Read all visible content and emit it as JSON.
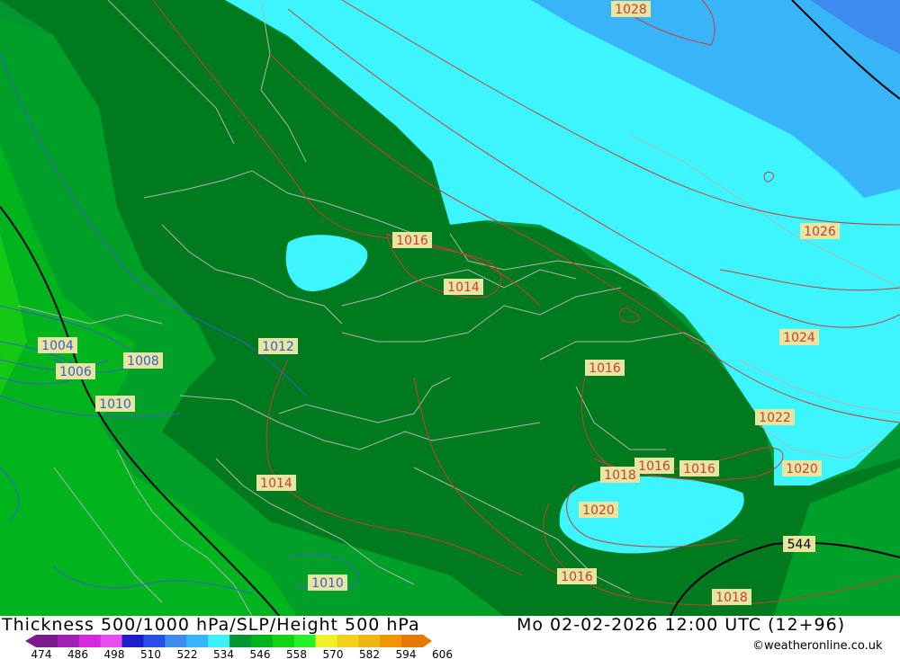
{
  "title": "Thickness 500/1000 hPa/SLP/Height 500 hPa",
  "datetime": "Mo 02-02-2026 12:00 UTC (12+96)",
  "credit": "©weatheronline.co.uk",
  "colors": {
    "isobar": "#cc3c3c",
    "isobar_low": "#3c5ad2",
    "height_contour": "#000000",
    "border": "#b4b4b4",
    "label_bg": "#e6e6a0"
  },
  "legend": {
    "ticks": [
      "474",
      "486",
      "498",
      "510",
      "522",
      "534",
      "546",
      "558",
      "570",
      "582",
      "594",
      "606"
    ],
    "colors": [
      "#7a1a8c",
      "#a020b4",
      "#d22adc",
      "#e64cf0",
      "#1e1ec8",
      "#2850e6",
      "#3c8cf0",
      "#38b4f8",
      "#3cf0f8",
      "#009632",
      "#00b41e",
      "#14d214",
      "#28f028",
      "#f0f028",
      "#f0d21e",
      "#f0b414",
      "#f09600",
      "#e67800"
    ]
  },
  "isobar_labels": [
    {
      "text": "1028",
      "color": "red"
    },
    {
      "text": "1026",
      "color": "red"
    },
    {
      "text": "1024",
      "color": "red"
    },
    {
      "text": "1022",
      "color": "red"
    },
    {
      "text": "1020",
      "color": "red"
    },
    {
      "text": "1016",
      "color": "red"
    },
    {
      "text": "1014",
      "color": "red"
    },
    {
      "text": "1016",
      "color": "red"
    },
    {
      "text": "1016",
      "color": "red"
    },
    {
      "text": "1016",
      "color": "red"
    },
    {
      "text": "1018",
      "color": "red"
    },
    {
      "text": "1020",
      "color": "red"
    },
    {
      "text": "1016",
      "color": "red"
    },
    {
      "text": "1018",
      "color": "red"
    },
    {
      "text": "1014",
      "color": "red"
    },
    {
      "text": "1012",
      "color": "blue"
    },
    {
      "text": "1004",
      "color": "blue"
    },
    {
      "text": "1006",
      "color": "blue"
    },
    {
      "text": "1008",
      "color": "blue"
    },
    {
      "text": "1010",
      "color": "blue"
    },
    {
      "text": "1010",
      "color": "blue"
    }
  ],
  "height_label": "544"
}
